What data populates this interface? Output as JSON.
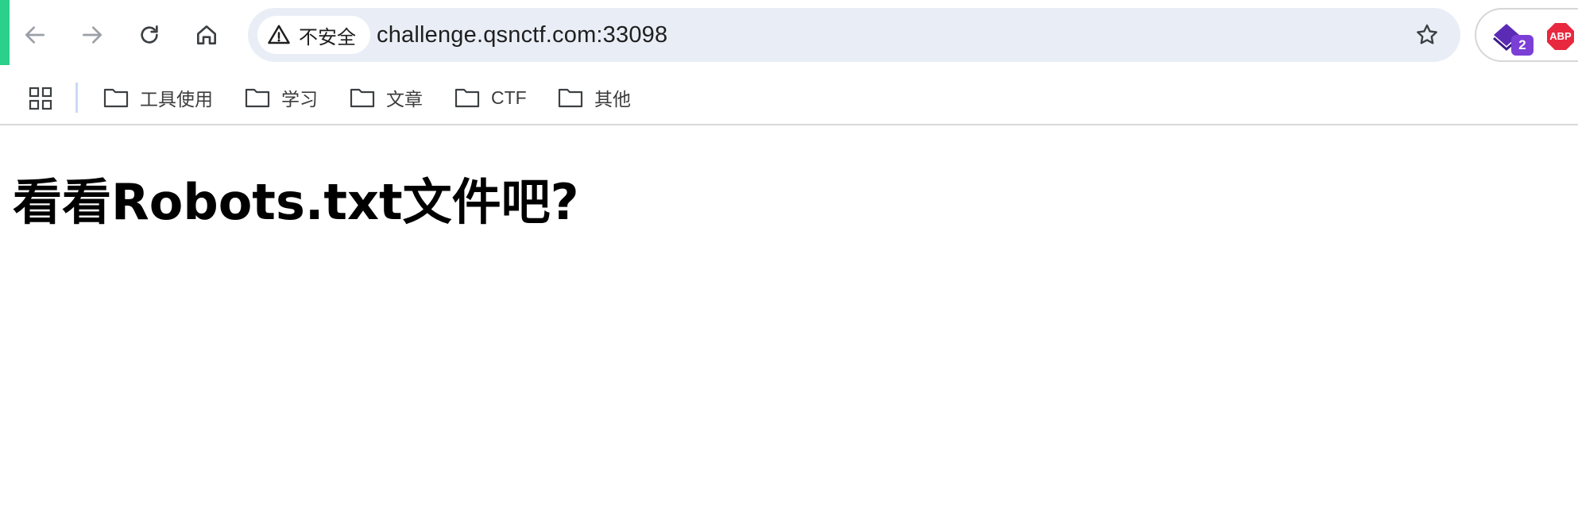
{
  "browser": {
    "security_label": "不安全",
    "url": "challenge.qsnctf.com:33098",
    "extension_badge": "2",
    "abp_label": "ABP",
    "colors": {
      "accent_strip": "#2bd08a",
      "omnibox_bg": "#e9eef6",
      "badge": "#7b3fd6",
      "abp": "#e8283f"
    }
  },
  "bookmarks": [
    {
      "label": "工具使用",
      "icon": "folder-icon"
    },
    {
      "label": "学习",
      "icon": "folder-icon"
    },
    {
      "label": "文章",
      "icon": "folder-icon"
    },
    {
      "label": "CTF",
      "icon": "folder-icon"
    },
    {
      "label": "其他",
      "icon": "folder-icon"
    }
  ],
  "page": {
    "heading": "看看Robots.txt文件吧?"
  }
}
